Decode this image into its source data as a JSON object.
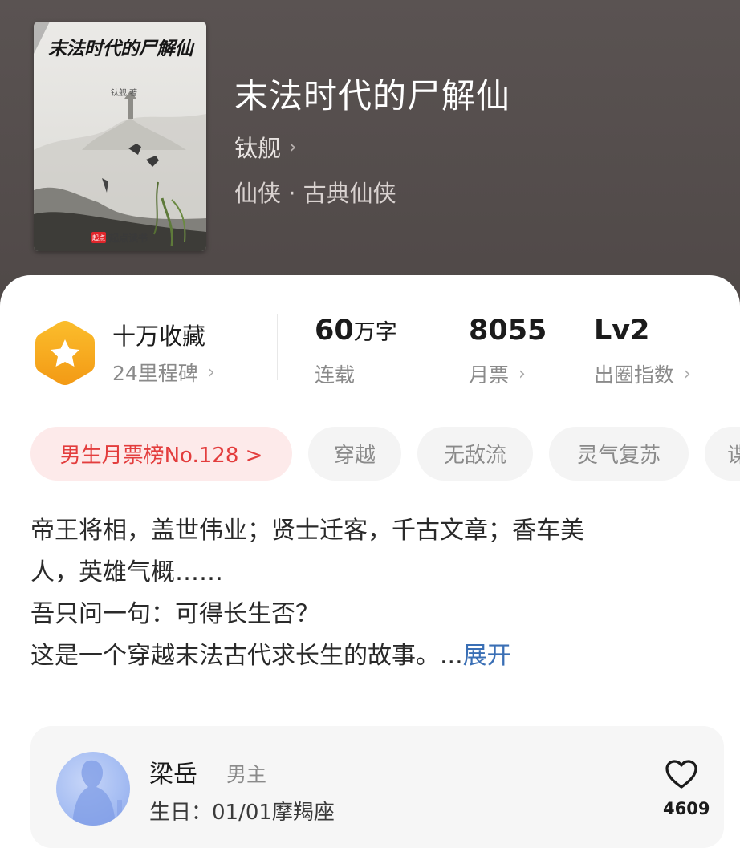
{
  "cover": {
    "title": "末法时代的尸解仙",
    "author": "钛舰 著",
    "publisher_badge": "起点",
    "publisher": "起点读书"
  },
  "book": {
    "title": "末法时代的尸解仙",
    "author": "钛舰",
    "genre": "仙侠 · 古典仙侠"
  },
  "stats": {
    "collect_main": "十万收藏",
    "collect_sub": "24里程碑",
    "words_value": "60",
    "words_unit": "万字",
    "words_label": "连载",
    "tickets_value": "8055",
    "tickets_label": "月票",
    "level_value": "Lv2",
    "level_label": "出圈指数"
  },
  "tags": {
    "rank": "男生月票榜No.128 >",
    "t1": "穿越",
    "t2": "无敌流",
    "t3": "灵气复苏",
    "t4": "谍"
  },
  "synopsis": {
    "line1": "帝王将相，盖世伟业；贤士迁客，千古文章；香车美",
    "line2": "人，英雄气概……",
    "line3": "吾只问一句：可得长生否？",
    "line4": "这是一个穿越末法古代求长生的故事。...",
    "expand": "展开"
  },
  "character": {
    "name": "梁岳",
    "role": "男主",
    "birthday": "生日：01/01摩羯座",
    "likes": "4609"
  },
  "icons": {
    "chevron": "chevron-right-icon",
    "star": "star-badge-icon",
    "heart": "heart-outline-icon"
  },
  "colors": {
    "header_bg": "#544d4c",
    "rank_tag_text": "#e33d3d",
    "rank_tag_bg": "#fdeaea",
    "expand_link": "#3a6fb5",
    "badge_orange": "#f7a51c"
  }
}
